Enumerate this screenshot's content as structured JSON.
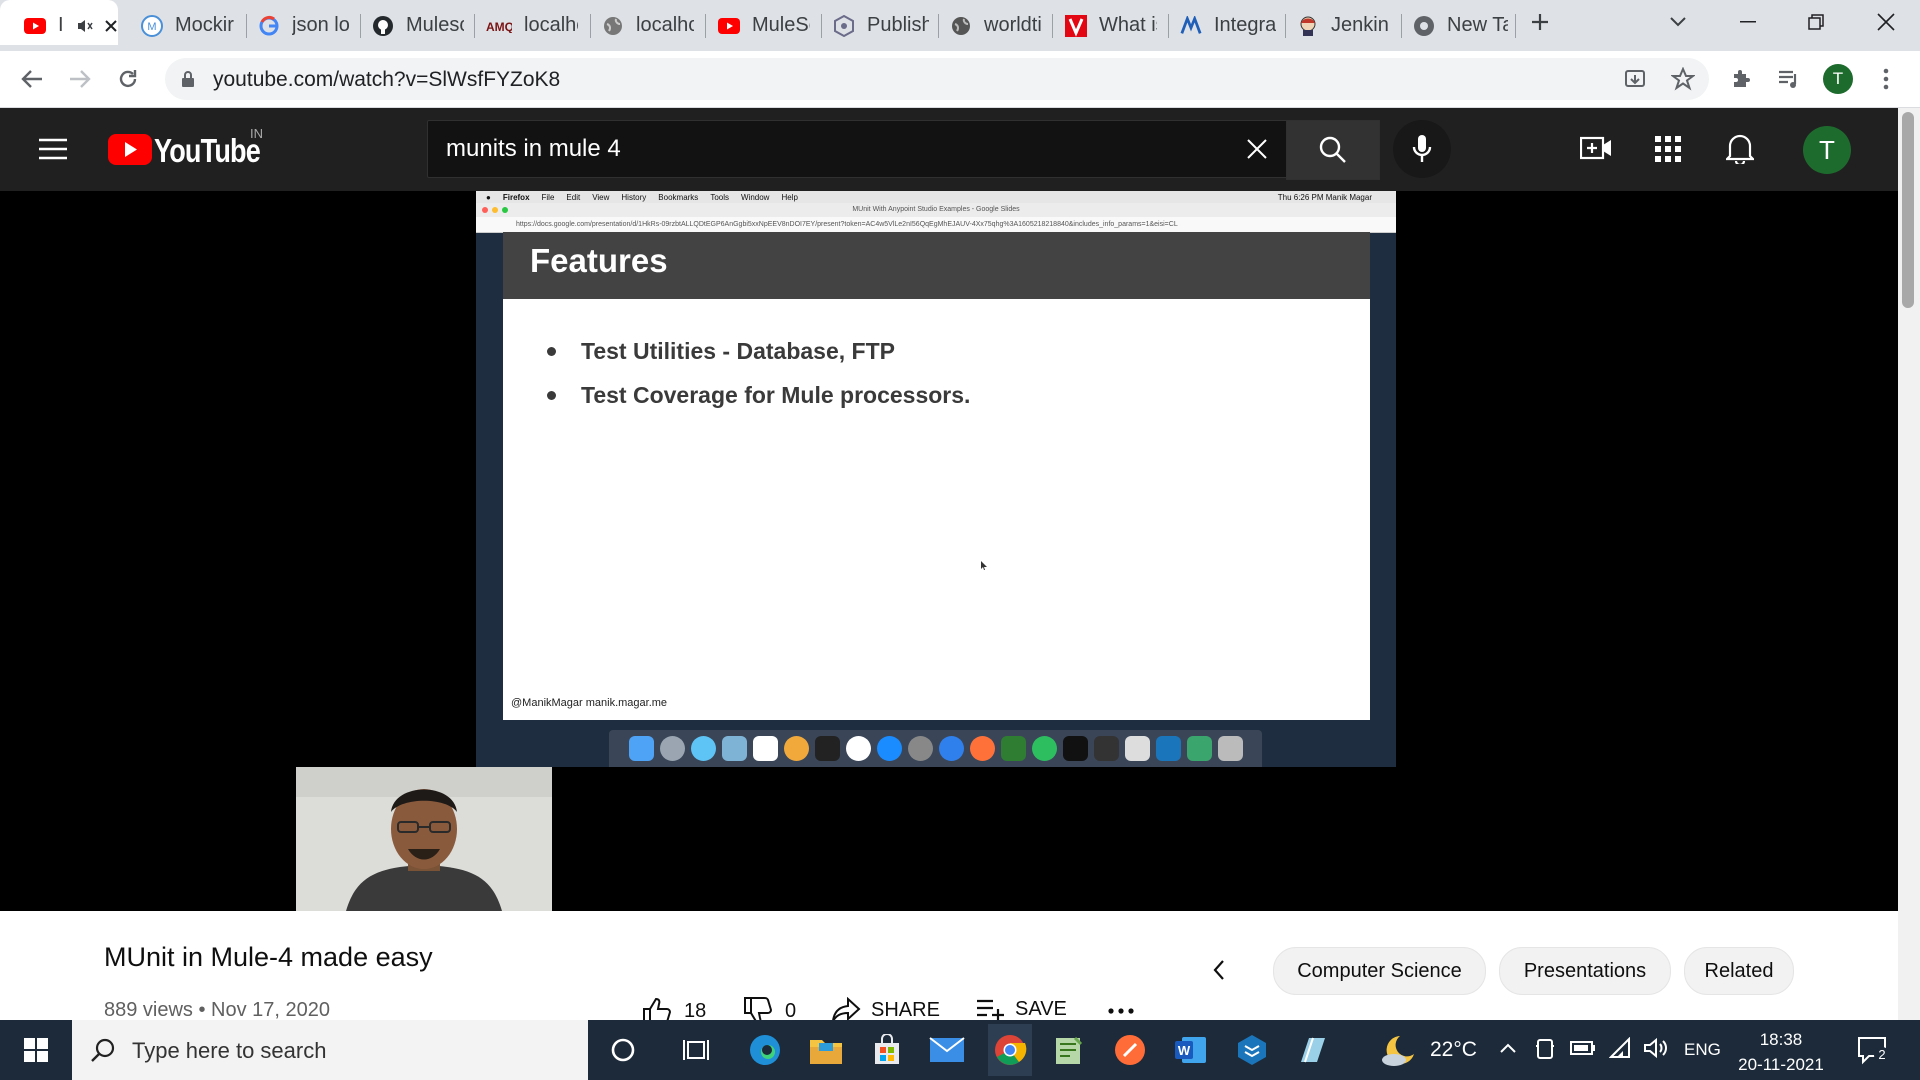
{
  "tabs": [
    {
      "title": "I",
      "icon": "youtube-icon",
      "active": true
    },
    {
      "title": "Mockir",
      "icon": "mockito-icon"
    },
    {
      "title": "json lo",
      "icon": "google-icon"
    },
    {
      "title": "Mulesc",
      "icon": "github-icon"
    },
    {
      "title": "localhc",
      "icon": "amq-icon"
    },
    {
      "title": "localhc",
      "icon": "globe-icon"
    },
    {
      "title": "MuleSc",
      "icon": "youtube-icon"
    },
    {
      "title": "Publish",
      "icon": "publish-icon"
    },
    {
      "title": "worldti",
      "icon": "globe-icon"
    },
    {
      "title": "What is",
      "icon": "v-icon"
    },
    {
      "title": "Integra",
      "icon": "anypoint-icon"
    },
    {
      "title": "Jenkins",
      "icon": "jenkins-icon"
    },
    {
      "title": "New Ta",
      "icon": "chrome-icon"
    }
  ],
  "browser": {
    "url": "youtube.com/watch?v=SlWsfFYZoK8",
    "profile_initial": "T"
  },
  "youtube": {
    "logo_text": "YouTube",
    "country_code": "IN",
    "search_query": "munits in mule 4",
    "avatar_initial": "T"
  },
  "slide": {
    "mac_menu": [
      "Firefox",
      "File",
      "Edit",
      "View",
      "History",
      "Bookmarks",
      "Tools",
      "Window",
      "Help"
    ],
    "mac_status": "Thu 6:26 PM   Manik Magar",
    "window_title": "MUnit With Anypoint Studio Examples - Google Slides",
    "slide_url": "https://docs.google.com/presentation/d/1HkRs-09rzbtALLQDtEGP6AnGgbi5xxNpEEV8nDOI7EY/present?token=AC4w5VlLe2nI56QqEgMhEJAUV-4Xx75qhg%3A1605218218840&includes_info_params=1&eisi=CL",
    "title": "Features",
    "bullets": [
      "Test Utilities - Database, FTP",
      "Test Coverage for Mule processors."
    ],
    "footer": "@ManikMagar manik.magar.me"
  },
  "video": {
    "title": "MUnit in Mule-4 made easy",
    "meta": "889 views • Nov 17, 2020",
    "likes": "18",
    "dislikes": "0",
    "share_label": "SHARE",
    "save_label": "SAVE",
    "chips": [
      "Computer Science",
      "Presentations",
      "Related"
    ]
  },
  "taskbar": {
    "search_placeholder": "Type here to search",
    "temperature": "22°C",
    "language": "ENG",
    "time": "18:38",
    "date": "20-11-2021",
    "notification_count": "2"
  }
}
